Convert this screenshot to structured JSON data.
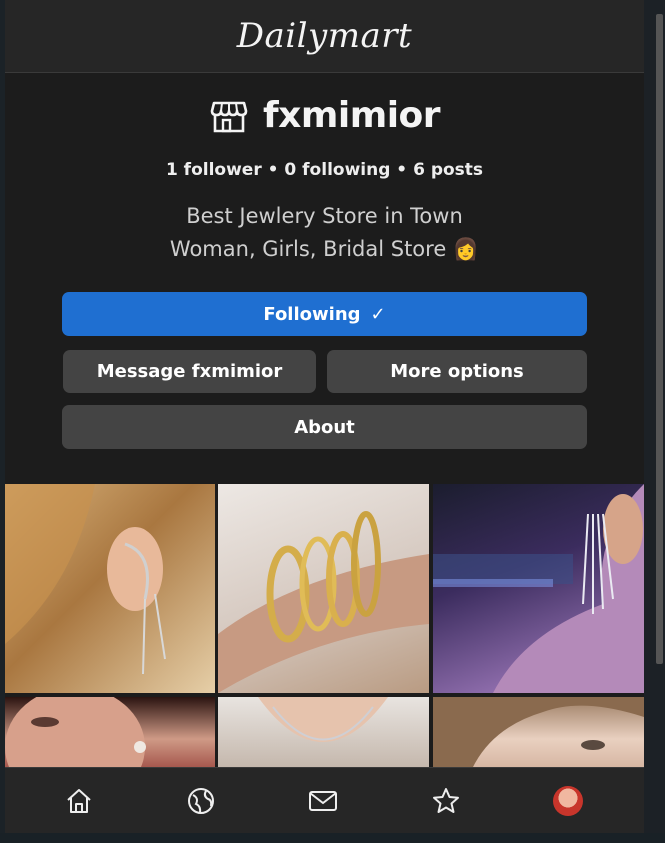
{
  "app": {
    "brand": "Dailymart"
  },
  "profile": {
    "username": "fxmimior",
    "stats": "1 follower • 0 following • 6 posts",
    "bio_line1": "Best Jewlery Store in Town",
    "bio_line2": "Woman, Girls, Bridal Store 👩"
  },
  "buttons": {
    "following": "Following",
    "following_check": "✓",
    "message": "Message fxmimior",
    "more": "More options",
    "about": "About"
  },
  "posts": [
    {
      "name": "post-ear-cuff-earring"
    },
    {
      "name": "post-gold-chain-bracelets"
    },
    {
      "name": "post-crystal-tassel-earring"
    },
    {
      "name": "post-pearl-earring-portrait"
    },
    {
      "name": "post-silver-necklace"
    },
    {
      "name": "post-woman-portrait"
    }
  ],
  "nav": {
    "icons": [
      "home-icon",
      "explore-icon",
      "mail-icon",
      "star-icon",
      "avatar"
    ]
  },
  "colors": {
    "accent": "#1f6fd1",
    "button_bg": "#444444",
    "surface": "#1c1c1c",
    "bar": "#262626"
  }
}
